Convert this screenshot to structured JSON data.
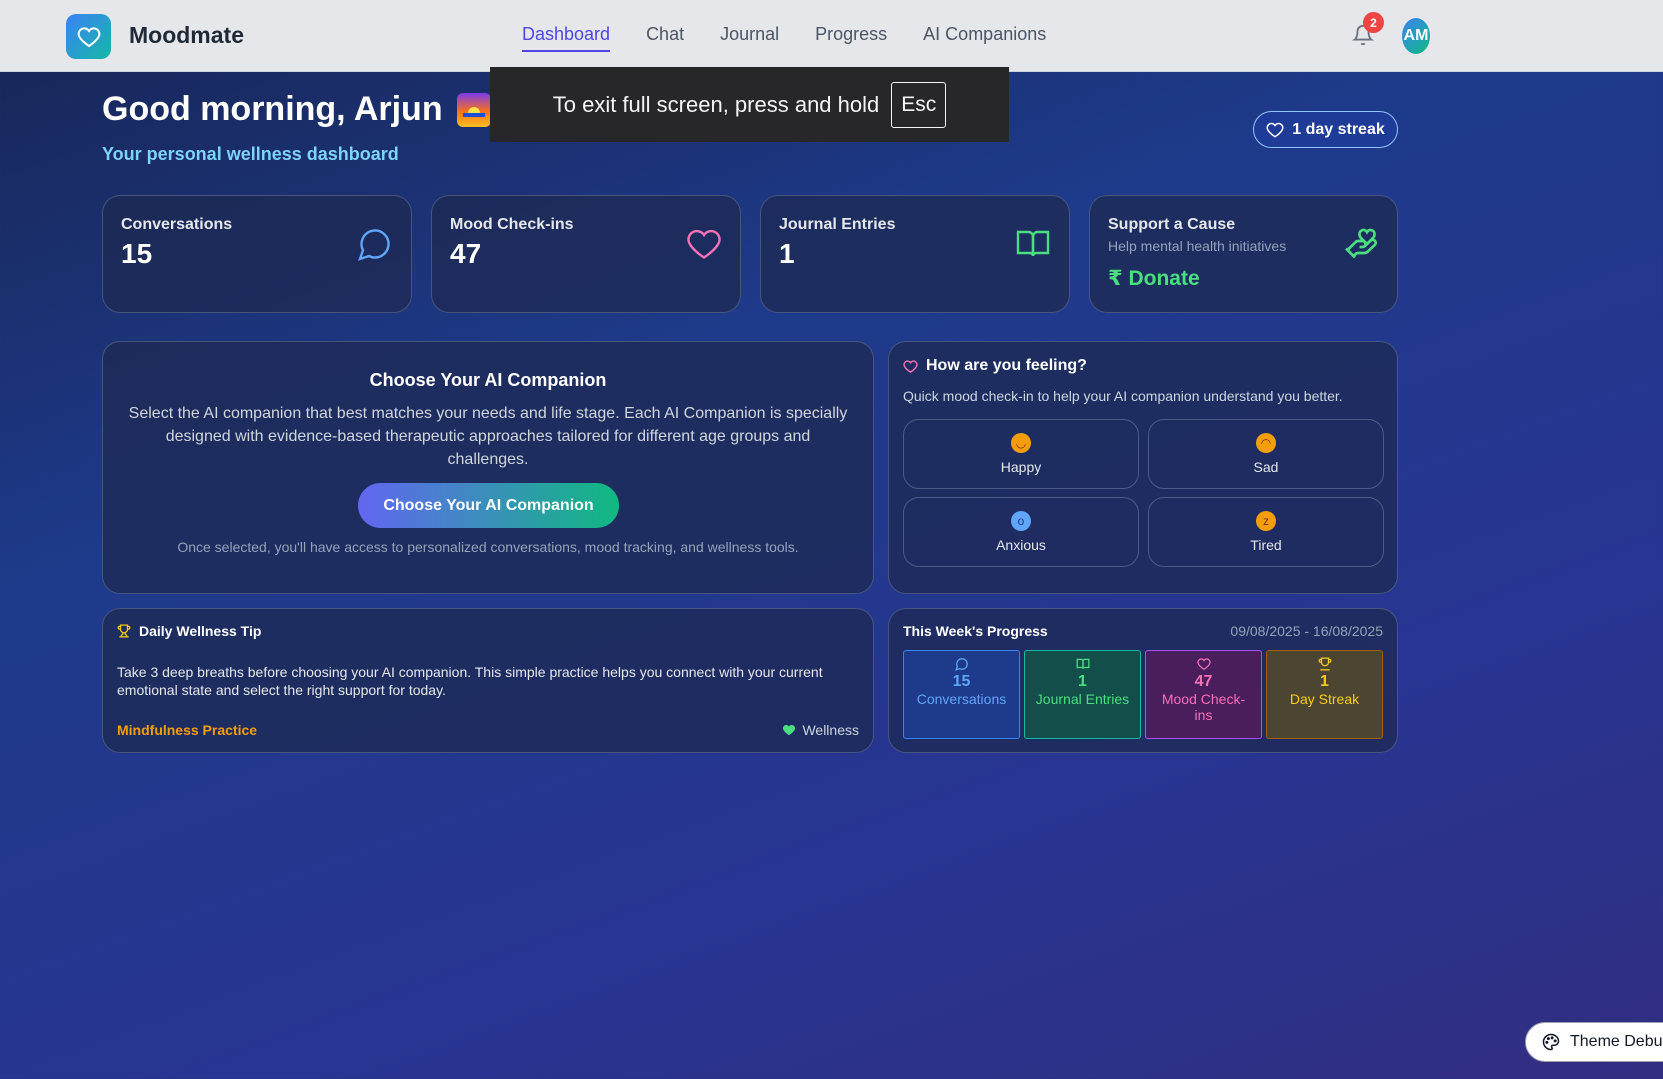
{
  "nav": {
    "brand": "Moodmate",
    "links": [
      "Dashboard",
      "Chat",
      "Journal",
      "Progress",
      "AI Companions"
    ],
    "active": "Dashboard",
    "notification_count": "2",
    "avatar_initials": "AM"
  },
  "fullscreen_toast": {
    "text": "To exit full screen, press and hold",
    "key": "Esc"
  },
  "header": {
    "greeting": "Good morning, Arjun",
    "subtitle": "Your personal wellness dashboard",
    "streak": "1 day streak"
  },
  "stats": [
    {
      "label": "Conversations",
      "value": "15",
      "icon": "chat-bubble-icon",
      "color": "#60a5fa"
    },
    {
      "label": "Mood Check-ins",
      "value": "47",
      "icon": "heart-icon",
      "color": "#f472b6"
    },
    {
      "label": "Journal Entries",
      "value": "1",
      "icon": "book-icon",
      "color": "#4ade80"
    }
  ],
  "donate": {
    "label": "Support a Cause",
    "subtitle": "Help mental health initiatives",
    "currency": "₹",
    "button": "Donate",
    "icon": "hand-heart-icon"
  },
  "companion": {
    "title": "Choose Your AI Companion",
    "description": "Select the AI companion that best matches your needs and life stage. Each AI Companion is specially designed with evidence-based therapeutic approaches tailored for different age groups and challenges.",
    "button": "Choose Your AI Companion",
    "note": "Once selected, you'll have access to personalized conversations, mood tracking, and wellness tools."
  },
  "mood": {
    "title": "How are you feeling?",
    "subtitle": "Quick mood check-in to help your AI companion understand you better.",
    "options": [
      {
        "label": "Happy",
        "emoji": "😊"
      },
      {
        "label": "Sad",
        "emoji": "😔"
      },
      {
        "label": "Anxious",
        "emoji": "😨"
      },
      {
        "label": "Tired",
        "emoji": "😴"
      }
    ]
  },
  "tip": {
    "title": "Daily Wellness Tip",
    "text": "Take 3 deep breaths before choosing your AI companion. This simple practice helps you connect with your current emotional state and select the right support for today.",
    "tag": "Mindfulness Practice",
    "category": "Wellness"
  },
  "progress": {
    "title": "This Week's Progress",
    "date_range": "09/08/2025 - 16/08/2025",
    "items": [
      {
        "value": "15",
        "label": "Conversations",
        "icon": "chat-bubble-icon",
        "color": "#60a5fa",
        "bg": "#1e3a8a",
        "border": "#3b82f6"
      },
      {
        "value": "1",
        "label": "Journal Entries",
        "icon": "book-icon",
        "color": "#4ade80",
        "bg": "#134e4a",
        "border": "#14b8a6"
      },
      {
        "value": "47",
        "label": "Mood Check-ins",
        "icon": "heart-icon",
        "color": "#f472b6",
        "bg": "#4a1d5c",
        "border": "#a855f7"
      },
      {
        "value": "1",
        "label": "Day Streak",
        "icon": "trophy-icon",
        "color": "#facc15",
        "bg": "#4b4532",
        "border": "#a16207"
      }
    ]
  },
  "theme_debug": {
    "label": "Theme Debu"
  }
}
